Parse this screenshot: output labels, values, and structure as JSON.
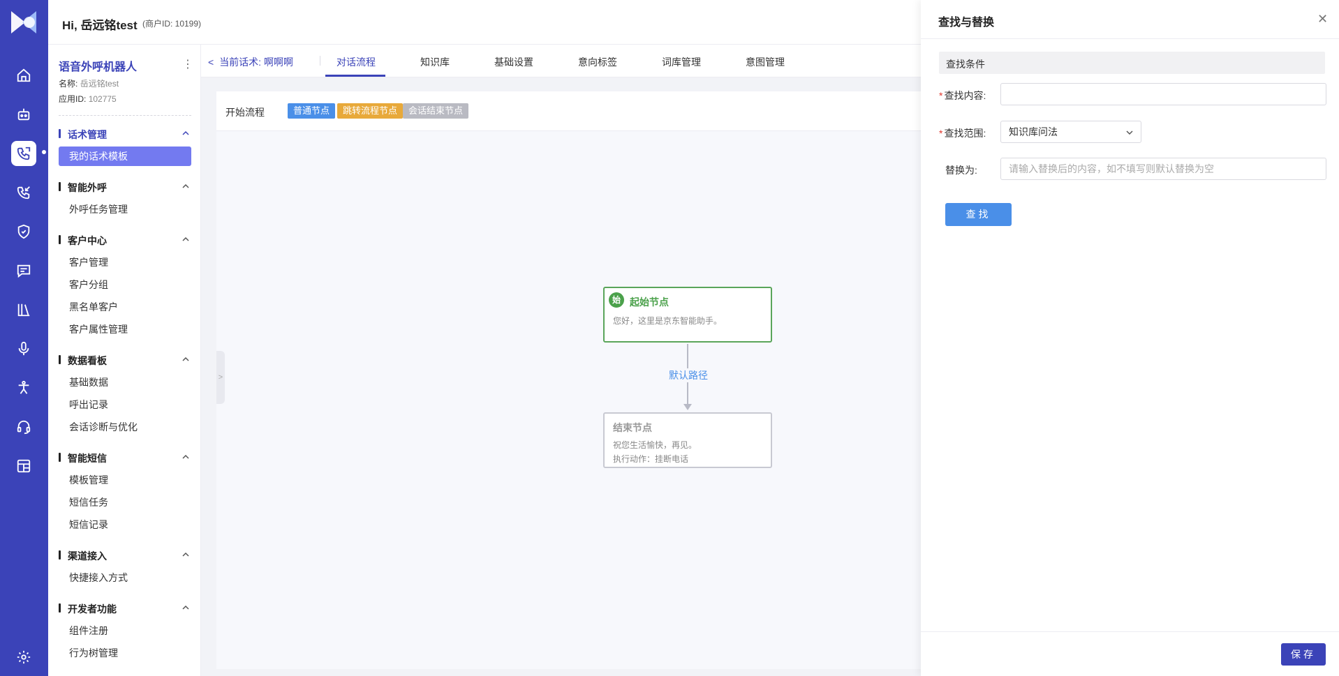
{
  "header": {
    "greeting": "Hi, 岳远铭test",
    "merchant_id": "(商户ID: 10199)"
  },
  "app": {
    "name": "语音外呼机器人",
    "name_label": "名称:",
    "name_value": "岳远铭test",
    "id_label": "应用ID:",
    "id_value": "102775"
  },
  "rail_icons": [
    "home-icon",
    "robot-icon",
    "phone-script-icon",
    "phone-call-icon",
    "shield-icon",
    "message-icon",
    "library-icon",
    "microphone-icon",
    "accessibility-icon",
    "headset-icon",
    "dashboard-grid-icon",
    "settings-icon"
  ],
  "menu": {
    "groups": [
      {
        "title": "话术管理",
        "items": [
          "我的话术模板"
        ]
      },
      {
        "title": "智能外呼",
        "items": [
          "外呼任务管理"
        ]
      },
      {
        "title": "客户中心",
        "items": [
          "客户管理",
          "客户分组",
          "黑名单客户",
          "客户属性管理"
        ]
      },
      {
        "title": "数据看板",
        "items": [
          "基础数据",
          "呼出记录",
          "会话诊断与优化"
        ]
      },
      {
        "title": "智能短信",
        "items": [
          "模板管理",
          "短信任务",
          "短信记录"
        ]
      },
      {
        "title": "渠道接入",
        "items": [
          "快捷接入方式"
        ]
      },
      {
        "title": "开发者功能",
        "items": [
          "组件注册",
          "行为树管理"
        ]
      }
    ]
  },
  "tabs": {
    "current_script_label": "当前话术:",
    "current_script_value": "啊啊啊",
    "items": [
      "对话流程",
      "知识库",
      "基础设置",
      "意向标签",
      "词库管理",
      "意图管理"
    ]
  },
  "legend": {
    "start_label": "开始流程",
    "tags": [
      {
        "label": "普通节点",
        "color": "#4a8fe8"
      },
      {
        "label": "跳转流程节点",
        "color": "#e8a93a"
      },
      {
        "label": "会话结束节点",
        "color": "#b9bac2"
      }
    ]
  },
  "flow": {
    "start_node": {
      "badge": "始",
      "title": "起始节点",
      "text": "您好，这里是京东智能助手。"
    },
    "edge_label": "默认路径",
    "end_node": {
      "title": "结束节点",
      "text": "祝您生活愉快，再见。",
      "action": "执行动作：挂断电话"
    }
  },
  "drawer": {
    "title": "查找与替换",
    "section": "查找条件",
    "find_label": "查找内容:",
    "find_value": "",
    "scope_label": "查找范围:",
    "scope_value": "知识库问法",
    "replace_label": "替换为:",
    "replace_placeholder": "请输入替换后的内容，如不填写则默认替换为空",
    "find_button": "查找",
    "save_button": "保存"
  },
  "colors": {
    "brand": "#3b43b8",
    "accent_blue": "#4a8fe8",
    "start_green": "#4ba14b",
    "required_red": "#e0362c"
  }
}
